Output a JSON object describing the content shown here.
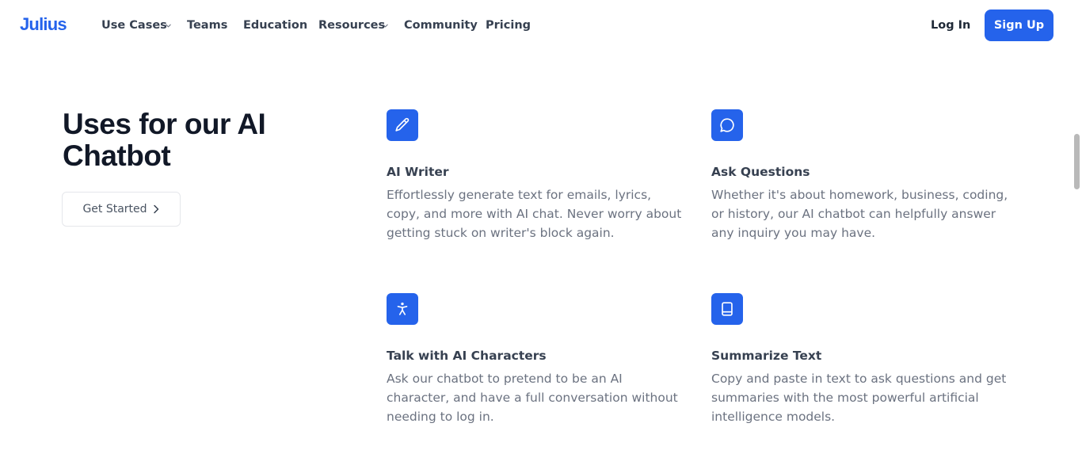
{
  "header": {
    "logo": "Julius",
    "nav": [
      {
        "label": "Use Cases",
        "has_dropdown": true
      },
      {
        "label": "Teams",
        "has_dropdown": false
      },
      {
        "label": "Education",
        "has_dropdown": false
      },
      {
        "label": "Resources",
        "has_dropdown": true
      },
      {
        "label": "Community",
        "has_dropdown": false
      },
      {
        "label": "Pricing",
        "has_dropdown": false
      }
    ],
    "login_label": "Log In",
    "signup_label": "Sign Up"
  },
  "hero": {
    "title": "Uses for our AI Chatbot",
    "cta_label": "Get Started"
  },
  "features": [
    {
      "icon": "pencil-icon",
      "title": "AI Writer",
      "description": "Effortlessly generate text for emails, lyrics, copy, and more with AI chat. Never worry about getting stuck on writer's block again."
    },
    {
      "icon": "chat-bubble-icon",
      "title": "Ask Questions",
      "description": "Whether it's about homework, business, coding, or history, our AI chatbot can helpfully answer any inquiry you may have."
    },
    {
      "icon": "accessibility-person-icon",
      "title": "Talk with AI Characters",
      "description": "Ask our chatbot to pretend to be an AI character, and have a full conversation without needing to log in."
    },
    {
      "icon": "book-icon",
      "title": "Summarize Text",
      "description": "Copy and paste in text to ask questions and get summaries with the most powerful artificial intelligence models."
    }
  ],
  "colors": {
    "brand": "#2563eb",
    "heading": "#111827",
    "body_text": "#6b7280"
  }
}
